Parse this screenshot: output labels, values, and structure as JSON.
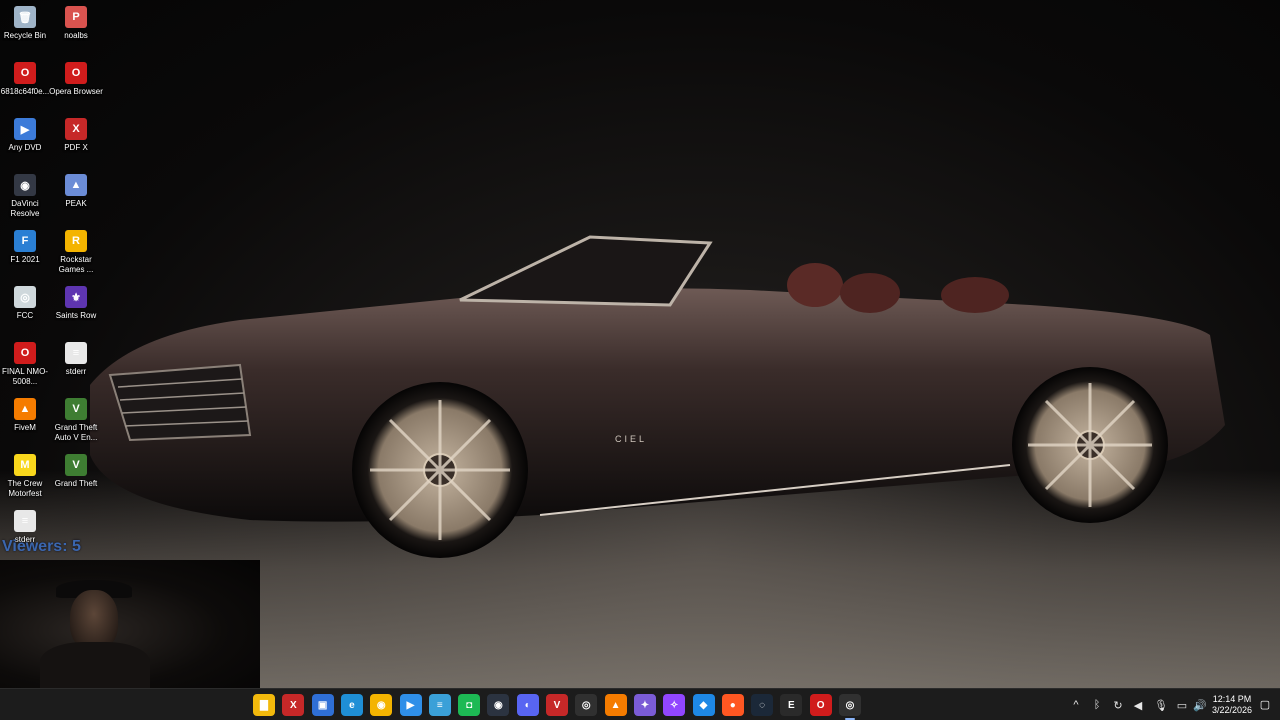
{
  "desktop": {
    "icons": [
      {
        "label": "Recycle Bin",
        "icon": "recycle-bin-icon",
        "color": "#9fb4c8",
        "glyph": "🗑"
      },
      {
        "label": "noalbs",
        "icon": "noalbs-icon",
        "color": "#d9534f",
        "glyph": "P"
      },
      {
        "label": "6818c64f0e...",
        "icon": "opera-icon",
        "color": "#d01c1c",
        "glyph": "O"
      },
      {
        "label": "Opera Browser",
        "icon": "opera-browser-icon",
        "color": "#d01c1c",
        "glyph": "O"
      },
      {
        "label": "Any DVD",
        "icon": "anydvd-icon",
        "color": "#3c7bd9",
        "glyph": "▶"
      },
      {
        "label": "PDF X",
        "icon": "pdf-x-icon",
        "color": "#c62828",
        "glyph": "X"
      },
      {
        "label": "DaVinci Resolve",
        "icon": "davinci-resolve-icon",
        "color": "#333844",
        "glyph": "◉"
      },
      {
        "label": "PEAK",
        "icon": "peak-icon",
        "color": "#6b8cd6",
        "glyph": "▲"
      },
      {
        "label": "F1 2021",
        "icon": "f1-2021-icon",
        "color": "#2a7fd4",
        "glyph": "F"
      },
      {
        "label": "Rockstar Games ...",
        "icon": "rockstar-games-icon",
        "color": "#f4b400",
        "glyph": "R"
      },
      {
        "label": "FCC",
        "icon": "fcc-icon",
        "color": "#cfd8dc",
        "glyph": "◎"
      },
      {
        "label": "Saints Row",
        "icon": "saints-row-icon",
        "color": "#5e35b1",
        "glyph": "⚜"
      },
      {
        "label": "FINAL NMO-5008...",
        "icon": "opera-final-icon",
        "color": "#d01c1c",
        "glyph": "O"
      },
      {
        "label": "stderr",
        "icon": "text-file-icon",
        "color": "#e8e8e8",
        "glyph": "≡"
      },
      {
        "label": "FiveM",
        "icon": "fivem-icon",
        "color": "#f57c00",
        "glyph": "▲"
      },
      {
        "label": "Grand Theft Auto V En...",
        "icon": "gta-v-icon",
        "color": "#3e7d32",
        "glyph": "V"
      },
      {
        "label": "The Crew Motorfest",
        "icon": "the-crew-motorfest-icon",
        "color": "#f9d71c",
        "glyph": "M"
      },
      {
        "label": "Grand Theft",
        "icon": "gta-v-icon",
        "color": "#3e7d32",
        "glyph": "V"
      },
      {
        "label": "stderr",
        "icon": "text-file-icon",
        "color": "#e8e8e8",
        "glyph": "≡"
      }
    ]
  },
  "overlay": {
    "viewers_text": "Viewers: 5"
  },
  "wallpaper": {
    "badge_text": "CIEL"
  },
  "taskbar": {
    "apps": [
      {
        "name": "file-explorer-icon",
        "color": "#f2b90c",
        "glyph": "▇"
      },
      {
        "name": "pdf-x-icon",
        "color": "#c62828",
        "glyph": "X"
      },
      {
        "name": "app-folder-icon",
        "color": "#2f6fd6",
        "glyph": "▣"
      },
      {
        "name": "edge-icon",
        "color": "#1f8fd6",
        "glyph": "e"
      },
      {
        "name": "chrome-icon",
        "color": "#f4b400",
        "glyph": "◉"
      },
      {
        "name": "media-player-icon",
        "color": "#2f8fe8",
        "glyph": "▶"
      },
      {
        "name": "notepad-icon",
        "color": "#3aa0d8",
        "glyph": "≡"
      },
      {
        "name": "app-green-icon",
        "color": "#1db954",
        "glyph": "◘"
      },
      {
        "name": "davinci-resolve-icon",
        "color": "#2b3340",
        "glyph": "◉"
      },
      {
        "name": "discord-icon",
        "color": "#5865f2",
        "glyph": "◐"
      },
      {
        "name": "voicemeeter-icon",
        "color": "#c62828",
        "glyph": "V"
      },
      {
        "name": "obs-icon",
        "color": "#303030",
        "glyph": "◎"
      },
      {
        "name": "fivem-icon",
        "color": "#f57c00",
        "glyph": "▲"
      },
      {
        "name": "gamepad-icon",
        "color": "#7b5cd6",
        "glyph": "✦"
      },
      {
        "name": "twitch-icon",
        "color": "#9146ff",
        "glyph": "✧"
      },
      {
        "name": "app-blue-icon",
        "color": "#1e88e5",
        "glyph": "◆"
      },
      {
        "name": "app-orange-icon",
        "color": "#ff5722",
        "glyph": "●"
      },
      {
        "name": "steam-icon",
        "color": "#1b2838",
        "glyph": "◌"
      },
      {
        "name": "epic-games-icon",
        "color": "#2a2a2a",
        "glyph": "E"
      },
      {
        "name": "opera-icon",
        "color": "#d01c1c",
        "glyph": "O"
      },
      {
        "name": "obs-active-icon",
        "color": "#303030",
        "glyph": "◎"
      }
    ],
    "tray": [
      {
        "name": "chevron-up-icon",
        "glyph": "^"
      },
      {
        "name": "bluetooth-icon",
        "glyph": "ᛒ"
      },
      {
        "name": "refresh-app-icon",
        "glyph": "↻"
      },
      {
        "name": "speaker-app-icon",
        "glyph": "◀"
      },
      {
        "name": "microphone-icon",
        "glyph": "🎙"
      },
      {
        "name": "network-icon",
        "glyph": "▭"
      },
      {
        "name": "volume-icon",
        "glyph": "🔊"
      }
    ],
    "time": "12:14 PM",
    "date": "3/22/2026"
  }
}
